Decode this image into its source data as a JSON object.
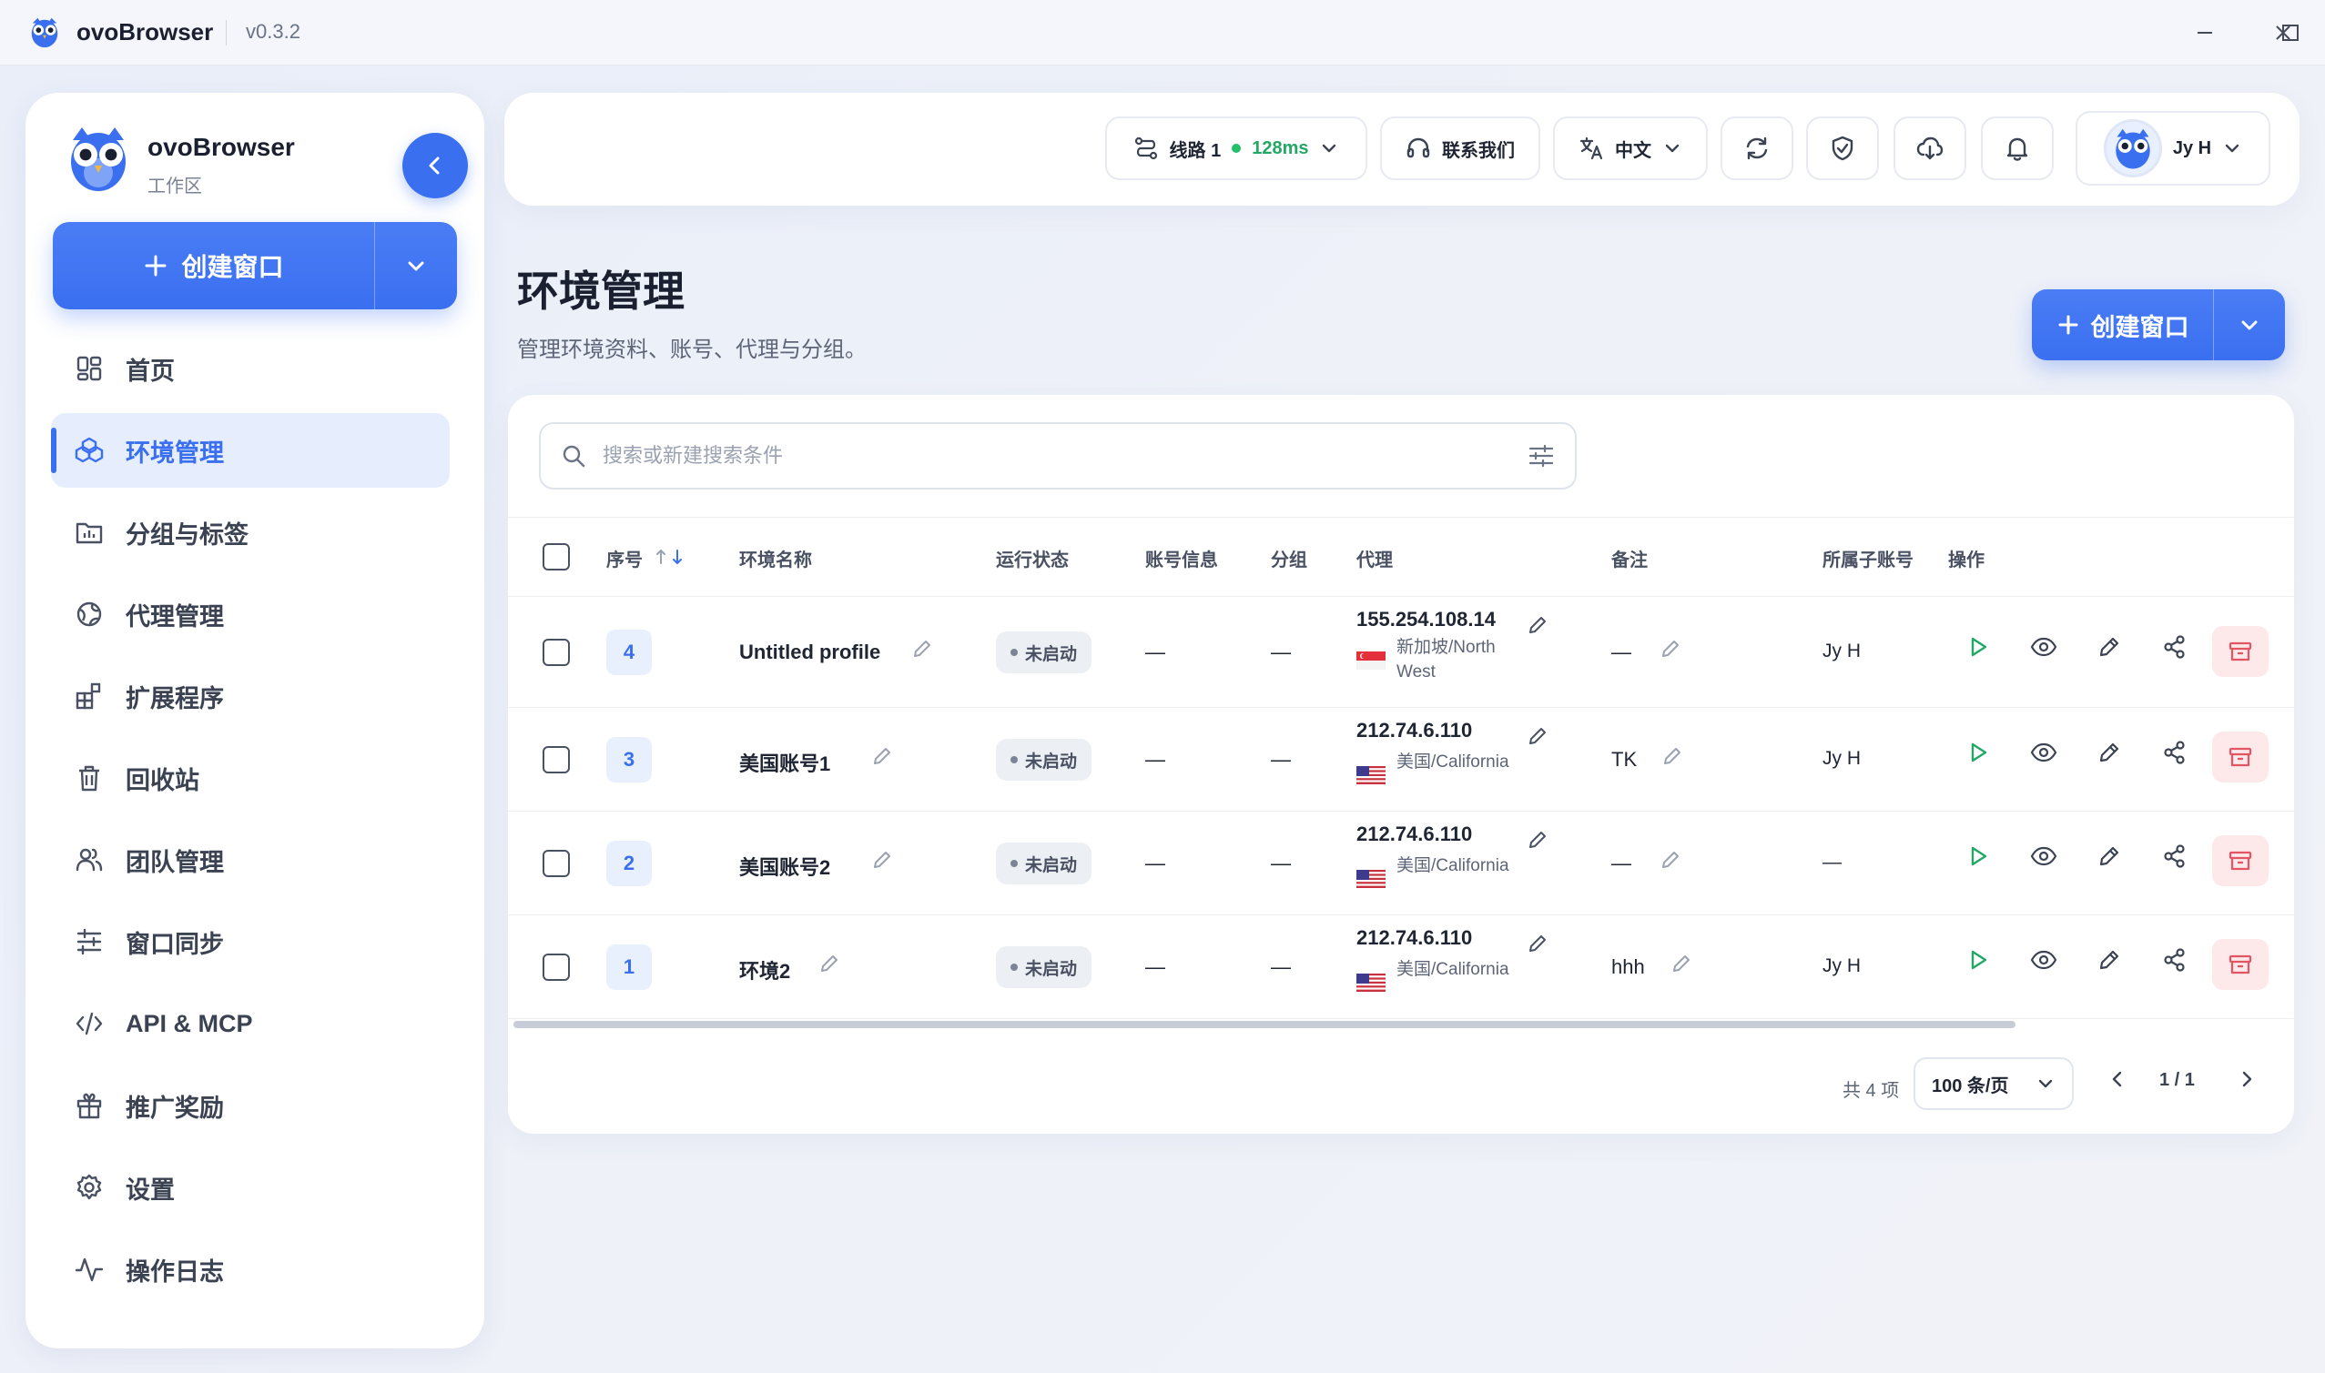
{
  "window": {
    "app_name": "ovoBrowser",
    "version": "v0.3.2"
  },
  "sidebar": {
    "brand": "ovoBrowser",
    "workspace": "工作区",
    "create_label": "创建窗口",
    "items": [
      {
        "label": "首页",
        "icon": "dashboard-icon"
      },
      {
        "label": "环境管理",
        "icon": "cubes-icon",
        "active": true
      },
      {
        "label": "分组与标签",
        "icon": "folder-chart-icon"
      },
      {
        "label": "代理管理",
        "icon": "globe-icon"
      },
      {
        "label": "扩展程序",
        "icon": "blocks-icon"
      },
      {
        "label": "回收站",
        "icon": "trash-icon"
      },
      {
        "label": "团队管理",
        "icon": "users-icon"
      },
      {
        "label": "窗口同步",
        "icon": "sliders-icon"
      },
      {
        "label": "API & MCP",
        "icon": "code-icon"
      },
      {
        "label": "推广奖励",
        "icon": "gift-icon"
      },
      {
        "label": "设置",
        "icon": "gear-icon"
      },
      {
        "label": "操作日志",
        "icon": "activity-icon"
      }
    ]
  },
  "header": {
    "route_label": "线路 1",
    "latency": "128ms",
    "contact_label": "联系我们",
    "language": "中文",
    "user_name": "Jy H"
  },
  "page": {
    "title": "环境管理",
    "subtitle": "管理环境资料、账号、代理与分组。",
    "create_label": "创建窗口"
  },
  "search": {
    "placeholder": "搜索或新建搜索条件"
  },
  "table": {
    "columns": [
      "序号",
      "环境名称",
      "运行状态",
      "账号信息",
      "分组",
      "代理",
      "备注",
      "所属子账号",
      "操作"
    ],
    "rows": [
      {
        "index": "4",
        "name": "Untitled profile",
        "status": "未启动",
        "account": "—",
        "group": "—",
        "proxy_ip": "155.254.108.14",
        "proxy_loc": "新加坡/North West",
        "flag": "sg",
        "note": "—",
        "owner": "Jy H"
      },
      {
        "index": "3",
        "name": "美国账号1",
        "status": "未启动",
        "account": "—",
        "group": "—",
        "proxy_ip": "212.74.6.110",
        "proxy_loc": "美国/California",
        "flag": "us",
        "note": "TK",
        "owner": "Jy H"
      },
      {
        "index": "2",
        "name": "美国账号2",
        "status": "未启动",
        "account": "—",
        "group": "—",
        "proxy_ip": "212.74.6.110",
        "proxy_loc": "美国/California",
        "flag": "us",
        "note": "—",
        "owner": "—"
      },
      {
        "index": "1",
        "name": "环境2",
        "status": "未启动",
        "account": "—",
        "group": "—",
        "proxy_ip": "212.74.6.110",
        "proxy_loc": "美国/California",
        "flag": "us",
        "note": "hhh",
        "owner": "Jy H"
      }
    ]
  },
  "footer": {
    "total": "共 4 项",
    "page_size": "100 条/页",
    "page": "1 / 1"
  },
  "colors": {
    "accent": "#3a6ff0",
    "success": "#22a864",
    "danger": "#e25563"
  }
}
